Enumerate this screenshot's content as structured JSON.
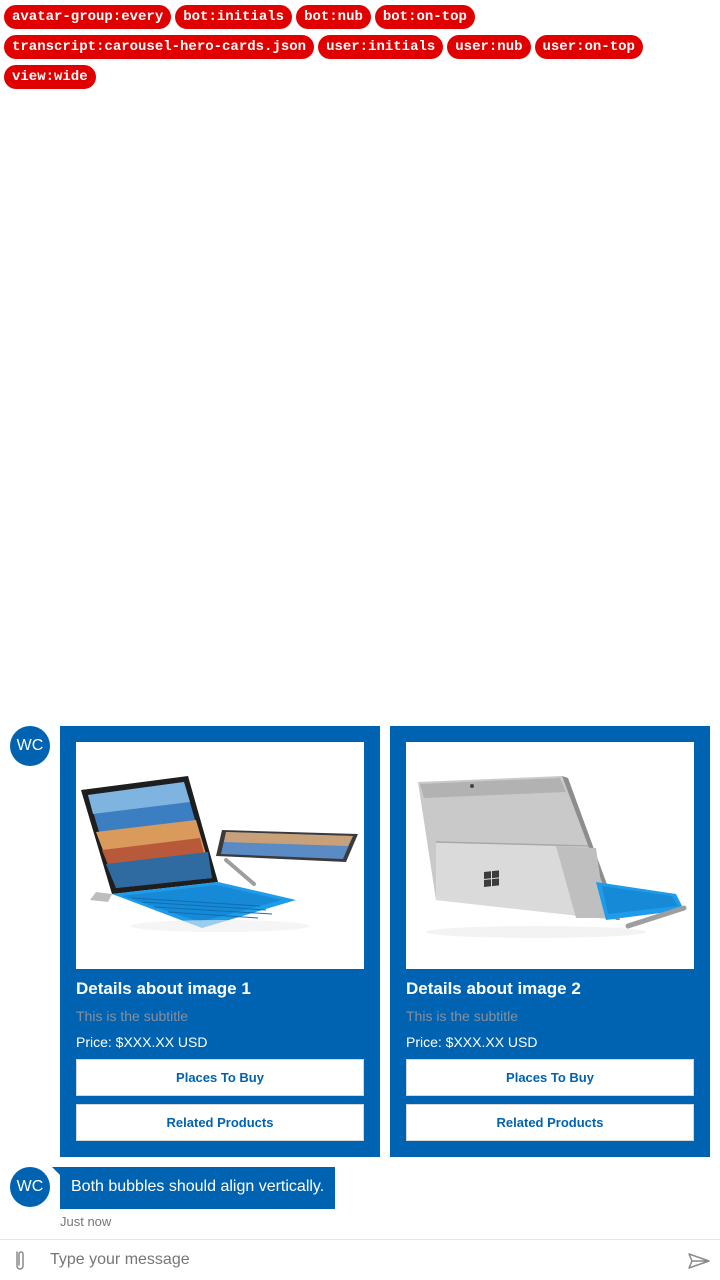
{
  "tags": [
    "avatar-group:every",
    "bot:initials",
    "bot:nub",
    "bot:on-top",
    "transcript:carousel-hero-cards.json",
    "user:initials",
    "user:nub",
    "user:on-top",
    "view:wide"
  ],
  "bot": {
    "initials": "WC"
  },
  "cards": [
    {
      "title": "Details about image 1",
      "subtitle": "This is the subtitle",
      "text": "Price: $XXX.XX USD",
      "buttons": [
        "Places To Buy",
        "Related Products"
      ]
    },
    {
      "title": "Details about image 2",
      "subtitle": "This is the subtitle",
      "text": "Price: $XXX.XX USD",
      "buttons": [
        "Places To Buy",
        "Related Products"
      ]
    }
  ],
  "message": {
    "text": "Both bubbles should align vertically.",
    "timestamp": "Just now"
  },
  "sendbox": {
    "placeholder": "Type your message"
  },
  "colors": {
    "accent": "#0063b1",
    "tag": "#e00000"
  }
}
